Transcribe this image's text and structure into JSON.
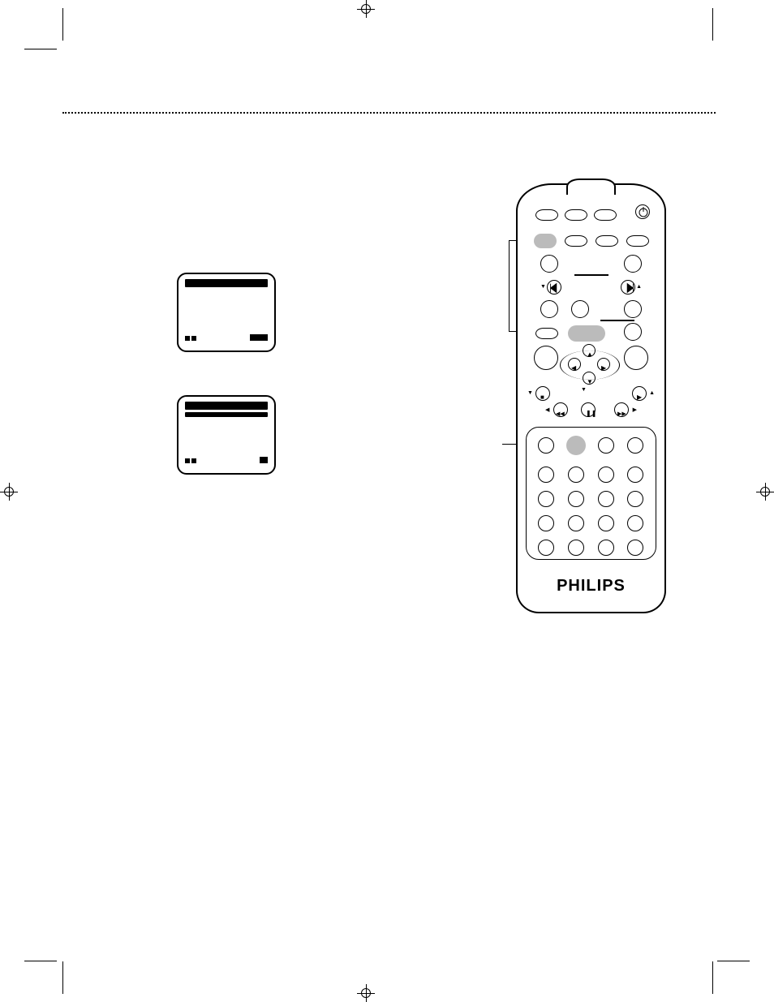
{
  "brand": "PHILIPS",
  "panels": {
    "panel1": {},
    "panel2": {}
  },
  "remote": {
    "highlights": [
      "top-left-oval-row2",
      "center-oval-row5",
      "grid-row1-col2"
    ]
  }
}
